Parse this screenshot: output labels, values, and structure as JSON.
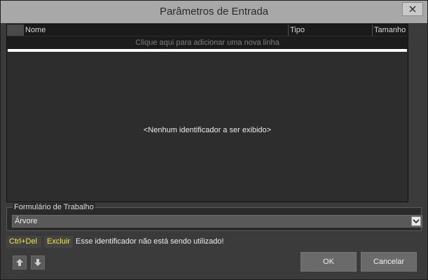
{
  "window": {
    "title": "Parâmetros de Entrada"
  },
  "grid": {
    "columns": [
      "Nome",
      "Tipo",
      "Tamanho"
    ],
    "add_row_hint": "Clique aqui para adicionar uma nova linha",
    "empty_message": "<Nenhum identificador a ser exibido>"
  },
  "work_form": {
    "legend": "Formulário de Trabalho",
    "selected": "Árvore"
  },
  "status_bar": {
    "shortcut": "Ctrl+Del",
    "action": "Excluir",
    "message": "Esse identificador não está sendo utilizado!"
  },
  "buttons": {
    "ok": "OK",
    "cancel": "Cancelar"
  },
  "icons": {
    "close": "close-icon",
    "dropdown": "chevron-down-icon",
    "move_up": "arrow-up-icon",
    "move_down": "arrow-down-icon"
  }
}
